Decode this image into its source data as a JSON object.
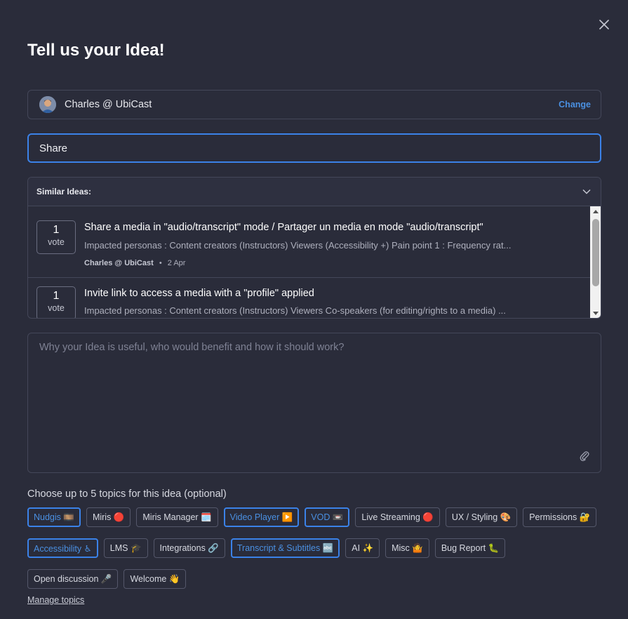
{
  "modal": {
    "title": "Tell us your Idea!"
  },
  "user": {
    "name": "Charles @ UbiCast",
    "change_label": "Change"
  },
  "title_input": {
    "value": "Share"
  },
  "similar_ideas": {
    "header": "Similar Ideas:",
    "items": [
      {
        "votes": "1",
        "vote_label": "vote",
        "title": "Share a media in \"audio/transcript\" mode / Partager un media en mode \"audio/transcript\"",
        "description": "Impacted personas : Content creators (Instructors) Viewers (Accessibility +) Pain point 1 : Frequency rat...",
        "author": "Charles @ UbiCast",
        "separator": "•",
        "date": "2 Apr"
      },
      {
        "votes": "1",
        "vote_label": "vote",
        "title": "Invite link to access a media with a \"profile\" applied",
        "description": "Impacted personas : Content creators (Instructors) Viewers Co-speakers (for editing/rights to a media) ..."
      }
    ]
  },
  "description_input": {
    "placeholder": "Why your Idea is useful, who would benefit and how it should work?"
  },
  "topics": {
    "label": "Choose up to 5 topics for this idea (optional)",
    "rows": [
      [
        {
          "label": "Nudgis 🎞️",
          "selected": true
        },
        {
          "label": "Miris 🔴",
          "selected": false
        },
        {
          "label": "Miris Manager 🗓️",
          "selected": false
        },
        {
          "label": "Video Player ▶️",
          "selected": true
        },
        {
          "label": "VOD 📼",
          "selected": true
        },
        {
          "label": "Live Streaming 🔴",
          "selected": false
        },
        {
          "label": "UX / Styling 🎨",
          "selected": false
        },
        {
          "label": "Permissions 🔐",
          "selected": false
        }
      ],
      [
        {
          "label": "Accessibility ♿",
          "selected": true
        },
        {
          "label": "LMS 🎓",
          "selected": false
        },
        {
          "label": "Integrations 🔗",
          "selected": false
        },
        {
          "label": "Transcript & Subtitles 🔤",
          "selected": true
        },
        {
          "label": "AI ✨",
          "selected": false
        },
        {
          "label": "Misc 🤷",
          "selected": false
        },
        {
          "label": "Bug Report 🐛",
          "selected": false
        }
      ],
      [
        {
          "label": "Open discussion 🎤",
          "selected": false
        },
        {
          "label": "Welcome 👋",
          "selected": false
        }
      ]
    ],
    "manage_label": "Manage topics"
  },
  "colors": {
    "background": "#2a2c3a",
    "accent": "#3b82e8",
    "link": "#4a90e2",
    "border": "#444759"
  }
}
